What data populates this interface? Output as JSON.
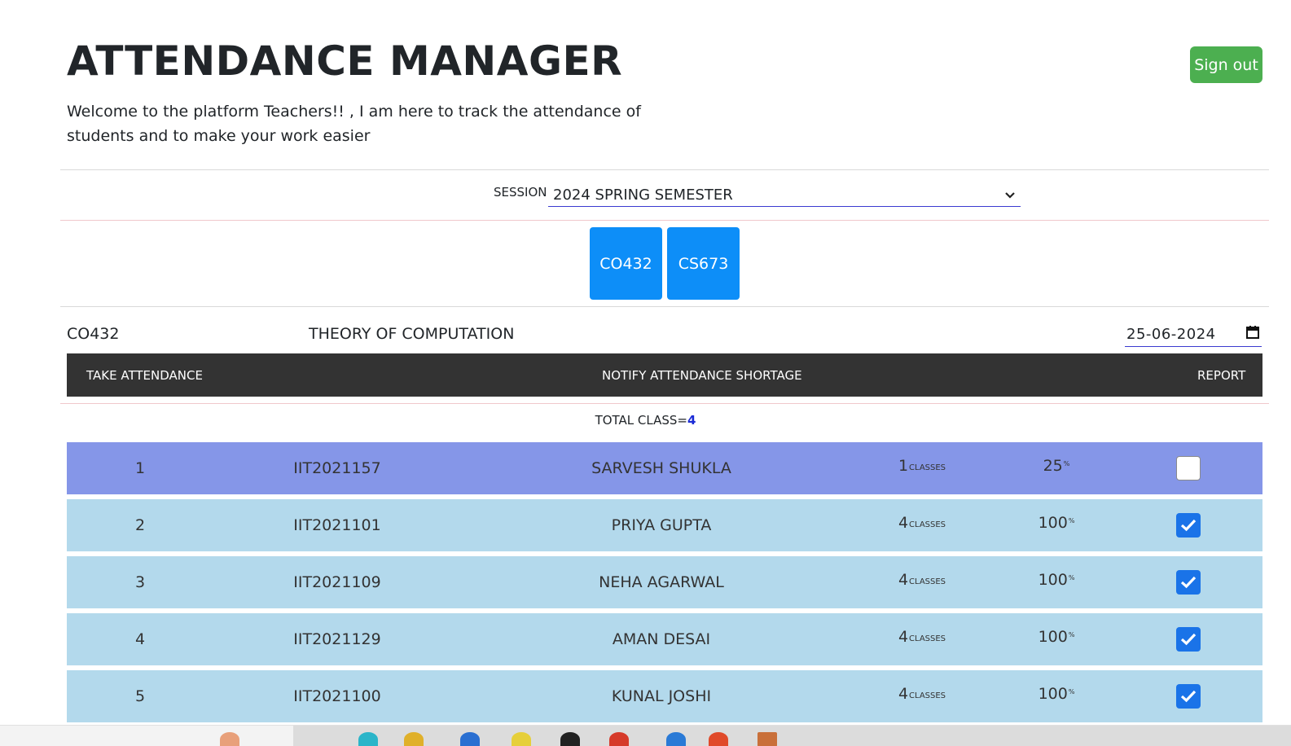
{
  "header": {
    "title": "ATTENDANCE MANAGER",
    "welcome": "Welcome to the platform Teachers!! , I am here to track the attendance of students and to make your work easier",
    "signout_label": "Sign out"
  },
  "session": {
    "label": "SESSION",
    "selected": "2024 SPRING SEMESTER"
  },
  "courses": [
    {
      "code": "CO432"
    },
    {
      "code": "CS673"
    }
  ],
  "current_course": {
    "code": "CO432",
    "name": "THEORY OF COMPUTATION",
    "date": "25-06-2024"
  },
  "actions": {
    "take": "TAKE ATTENDANCE",
    "notify": "NOTIFY ATTENDANCE SHORTAGE",
    "report": "REPORT"
  },
  "total": {
    "label": "TOTAL CLASS=",
    "value": "4"
  },
  "units": {
    "classes": "CLASSES",
    "percent": "%"
  },
  "students": [
    {
      "index": "1",
      "roll": "IIT2021157",
      "name": "SARVESH SHUKLA",
      "classes": "1",
      "percent": "25",
      "checked": false
    },
    {
      "index": "2",
      "roll": "IIT2021101",
      "name": "PRIYA GUPTA",
      "classes": "4",
      "percent": "100",
      "checked": true
    },
    {
      "index": "3",
      "roll": "IIT2021109",
      "name": "NEHA AGARWAL",
      "classes": "4",
      "percent": "100",
      "checked": true
    },
    {
      "index": "4",
      "roll": "IIT2021129",
      "name": "AMAN DESAI",
      "classes": "4",
      "percent": "100",
      "checked": true
    },
    {
      "index": "5",
      "roll": "IIT2021100",
      "name": "KUNAL JOSHI",
      "classes": "4",
      "percent": "100",
      "checked": true
    }
  ],
  "colors": {
    "signout": "#4caf50",
    "course_button": "#0d8ef8",
    "action_bar": "#333333",
    "row_highlight": "#8596e8",
    "row_normal": "#b3d9ec",
    "checkbox": "#1a73e8"
  }
}
